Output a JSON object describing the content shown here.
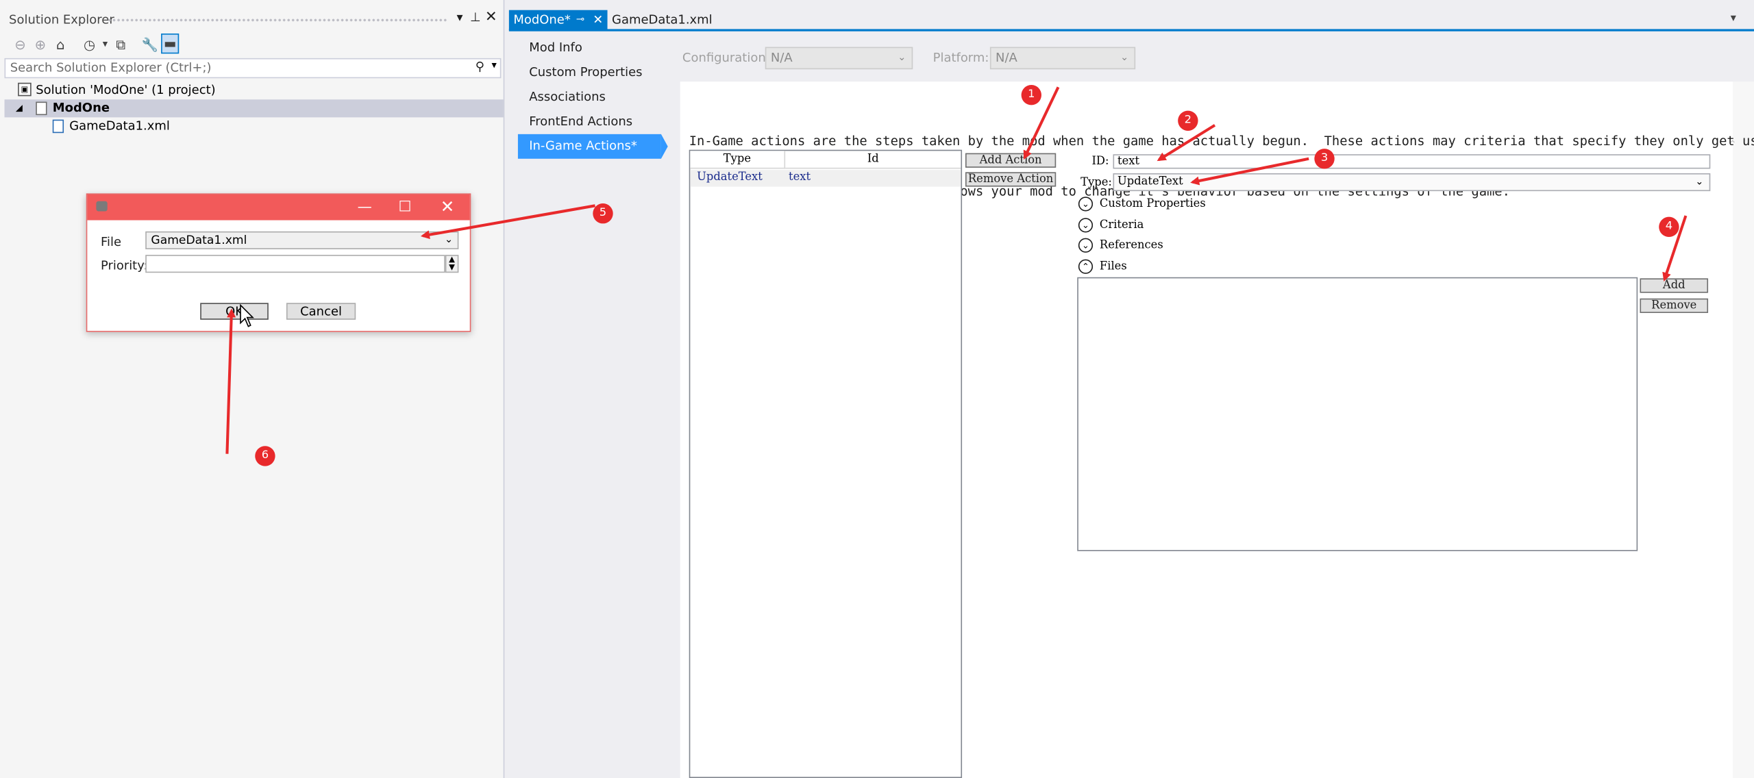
{
  "solution_explorer": {
    "title": "Solution Explorer",
    "search_placeholder": "Search Solution Explorer (Ctrl+;)",
    "tree": [
      {
        "label": "Solution 'ModOne' (1 project)"
      },
      {
        "label": "ModOne",
        "expander": "◢"
      },
      {
        "label": "GameData1.xml"
      }
    ]
  },
  "dialog": {
    "file_label": "File",
    "file_value": "GameData1.xml",
    "priority_label": "Priority:",
    "priority_value": "",
    "ok_label": "OK",
    "cancel_label": "Cancel"
  },
  "tabs": [
    {
      "label": "ModOne*"
    },
    {
      "label": "GameData1.xml"
    }
  ],
  "nav": [
    {
      "label": "Mod Info"
    },
    {
      "label": "Custom Properties"
    },
    {
      "label": "Associations"
    },
    {
      "label": "FrontEnd Actions"
    },
    {
      "label": "In-Game Actions*"
    }
  ],
  "config": {
    "configuration_label": "Configuration:",
    "configuration_value": "N/A",
    "platform_label": "Platform:",
    "platform_value": "N/A"
  },
  "description": {
    "line1": "In-Game actions are the steps taken by the mod when the game has actually begun.  These actions may criteria that specify they only get used",
    "line2": "in certain circumstances.  This allows your mod to change it's behavior based on the settings of the game."
  },
  "actions_table": {
    "columns": [
      "Type",
      "Id"
    ],
    "rows": [
      {
        "type": "UpdateText",
        "id": "text"
      }
    ]
  },
  "buttons": {
    "add_action": "Add Action",
    "remove_action": "Remove Action",
    "add": "Add",
    "remove": "Remove"
  },
  "detail": {
    "id_label": "ID:",
    "id_value": "text",
    "type_label": "Type:",
    "type_value": "UpdateText",
    "sections": [
      "Custom Properties",
      "Criteria",
      "References",
      "Files"
    ]
  },
  "annotations": [
    "1",
    "2",
    "3",
    "4",
    "5",
    "6"
  ],
  "colors": {
    "accent": "#007acc",
    "nav_selected": "#3399ff",
    "dialog_titlebar": "#f25a5a",
    "annotation_red": "#e8292b",
    "link_text": "#1a2b8c"
  }
}
